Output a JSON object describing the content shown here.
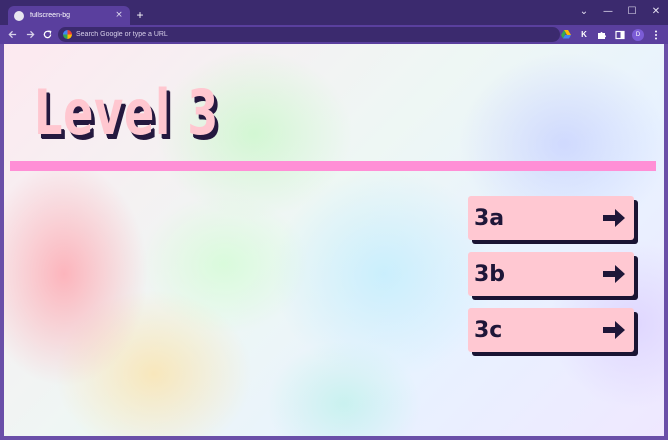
{
  "browser": {
    "tab_title": "fullscreen-bg",
    "tab_close": "×",
    "new_tab": "+",
    "omnibox_placeholder": "Search Google or type a URL",
    "profile_initial": "D",
    "controls": {
      "minimize": "⌄",
      "min": "—",
      "max": "☐",
      "close": "✕"
    }
  },
  "page": {
    "title": "Level 3",
    "levels": [
      {
        "label": "3a"
      },
      {
        "label": "3b"
      },
      {
        "label": "3c"
      }
    ]
  },
  "colors": {
    "chrome_dark": "#3b2a6e",
    "chrome_toolbar": "#5a3f9e",
    "title_fill": "#ffc7d0",
    "rule": "#ff8fd6",
    "button_fill": "#ffc8d2",
    "ink": "#1e1638"
  }
}
